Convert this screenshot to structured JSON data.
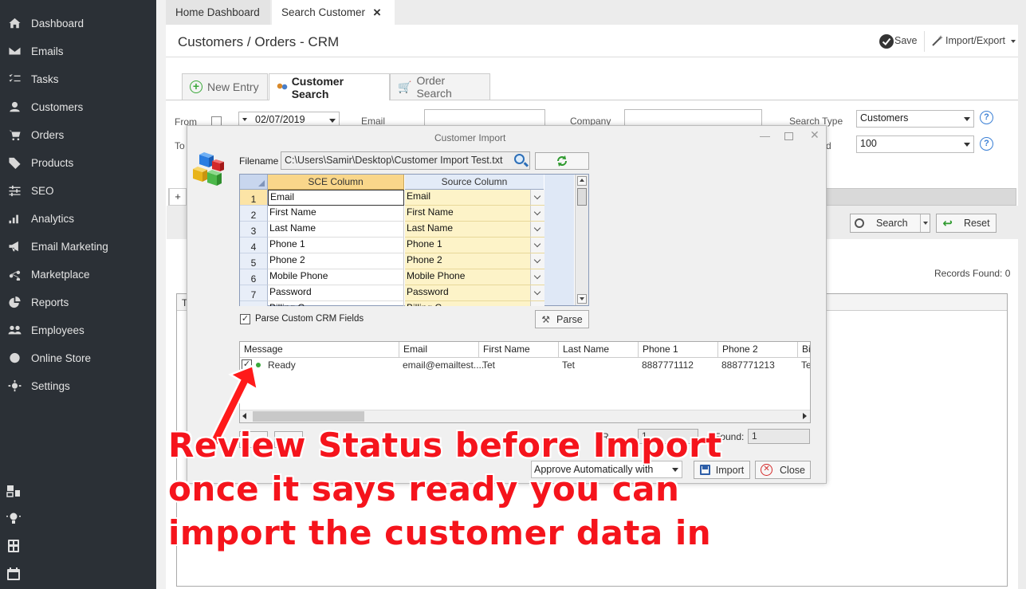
{
  "sidebar": {
    "items": [
      {
        "label": "Dashboard",
        "icon": "home-icon"
      },
      {
        "label": "Emails",
        "icon": "envelope-icon"
      },
      {
        "label": "Tasks",
        "icon": "tasks-icon"
      },
      {
        "label": "Customers",
        "icon": "user-icon"
      },
      {
        "label": "Orders",
        "icon": "cart-icon"
      },
      {
        "label": "Products",
        "icon": "tag-icon"
      },
      {
        "label": "SEO",
        "icon": "sliders-icon"
      },
      {
        "label": "Analytics",
        "icon": "bar-chart-icon"
      },
      {
        "label": "Email Marketing",
        "icon": "megaphone-icon"
      },
      {
        "label": "Marketplace",
        "icon": "share-icon"
      },
      {
        "label": "Reports",
        "icon": "pie-chart-icon"
      },
      {
        "label": "Employees",
        "icon": "users-icon"
      },
      {
        "label": "Online Store",
        "icon": "globe-icon"
      },
      {
        "label": "Settings",
        "icon": "gear-icon"
      }
    ]
  },
  "tabs": {
    "home": "Home Dashboard",
    "search": "Search Customer",
    "close": "×"
  },
  "header": {
    "title": "Customers / Orders - CRM",
    "save": "Save",
    "import_export": "Import/Export"
  },
  "subtabs": {
    "new_entry": "New Entry",
    "customer_search": "Customer Search",
    "order_search": "Order Search"
  },
  "form": {
    "from_label": "From",
    "to_label": "To",
    "date_value": "02/07/2019",
    "email_label": "Email",
    "company_label": "Company",
    "search_type_label": "Search Type",
    "search_type_value": "Customers",
    "count_label": "d",
    "count_value": "100",
    "plus": "+",
    "help": "?"
  },
  "actions": {
    "search": "Search",
    "reset": "Reset",
    "records_found": "Records Found: 0",
    "table_col_t": "T"
  },
  "dialog": {
    "title": "Customer Import",
    "filename_label": "Filename",
    "filename_value": "C:\\Users\\Samir\\Desktop\\Customer Import Test.txt",
    "sce_header": "SCE Column",
    "source_header": "Source Column",
    "mapping": [
      {
        "n": "1",
        "sce": "Email",
        "src": "Email"
      },
      {
        "n": "2",
        "sce": "First Name",
        "src": "First Name"
      },
      {
        "n": "3",
        "sce": "Last Name",
        "src": "Last Name"
      },
      {
        "n": "4",
        "sce": "Phone 1",
        "src": "Phone 1"
      },
      {
        "n": "5",
        "sce": "Phone 2",
        "src": "Phone 2"
      },
      {
        "n": "6",
        "sce": "Mobile Phone",
        "src": "Mobile Phone"
      },
      {
        "n": "7",
        "sce": "Password",
        "src": "Password"
      },
      {
        "n": "",
        "sce": "Billing C...",
        "src": "Billing C..."
      }
    ],
    "parse_custom_label": "Parse Custom CRM Fields",
    "parse_button": "Parse",
    "list_headers": [
      "Message",
      "Email",
      "First Name",
      "Last Name",
      "Phone 1",
      "Phone 2",
      "Bi"
    ],
    "list_row": [
      "Ready",
      "email@emailtest....",
      "Tet",
      "Tet",
      "8887771112",
      "8887771213",
      "Te"
    ],
    "r_label": "R",
    "r_value": "1",
    "found_label": "Found:",
    "found_value": "1",
    "approve_value": "Approve Automatically with",
    "import_button": "Import",
    "close_button": "Close"
  },
  "annotation": {
    "line1": "Review Status before Import",
    "line2": "once it says ready you can",
    "line3": "import the customer data in",
    "color": "#f5141c"
  }
}
